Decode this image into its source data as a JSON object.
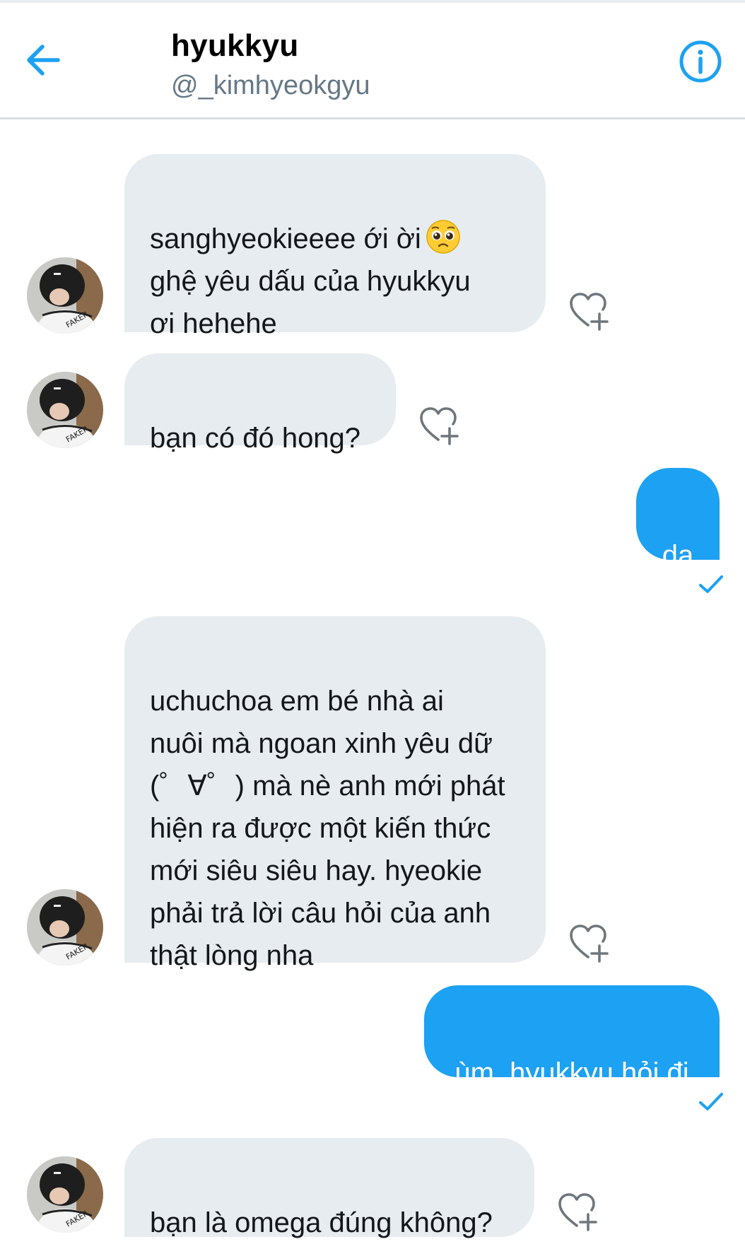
{
  "header": {
    "name": "hyukkyu",
    "handle": "@_kimhyeokgyu",
    "back_icon": "arrow-left-icon",
    "info_icon": "info-circle-icon"
  },
  "colors": {
    "accent": "#1da1f2",
    "incoming_bubble": "#e6ecf0",
    "handle_gray": "#657786"
  },
  "messages": [
    {
      "direction": "incoming",
      "text": "sanghyeokieeee ới ời",
      "emoji": "pleading-face",
      "text_rest": "ghệ yêu dấu của hyukkyu\nơi hehehe",
      "like_icon": "heart-plus-icon"
    },
    {
      "direction": "incoming",
      "text": "bạn có đó hong?",
      "like_icon": "heart-plus-icon"
    },
    {
      "direction": "outgoing",
      "text": "dạ",
      "status_icon": "check-icon"
    },
    {
      "direction": "incoming",
      "text": "uchuchoa em bé nhà ai\nnuôi mà ngoan xinh yêu dữ\n(゜∀゜) mà nè anh mới phát\nhiện ra được một kiến thức\nmới siêu siêu hay. hyeokie\nphải trả lời câu hỏi của anh\nthật lòng nha",
      "like_icon": "heart-plus-icon"
    },
    {
      "direction": "outgoing",
      "text": "ùm, hyukkyu hỏi đi",
      "status_icon": "check-icon"
    },
    {
      "direction": "incoming",
      "text": "bạn là omega đúng không?",
      "like_icon": "heart-plus-icon"
    }
  ]
}
